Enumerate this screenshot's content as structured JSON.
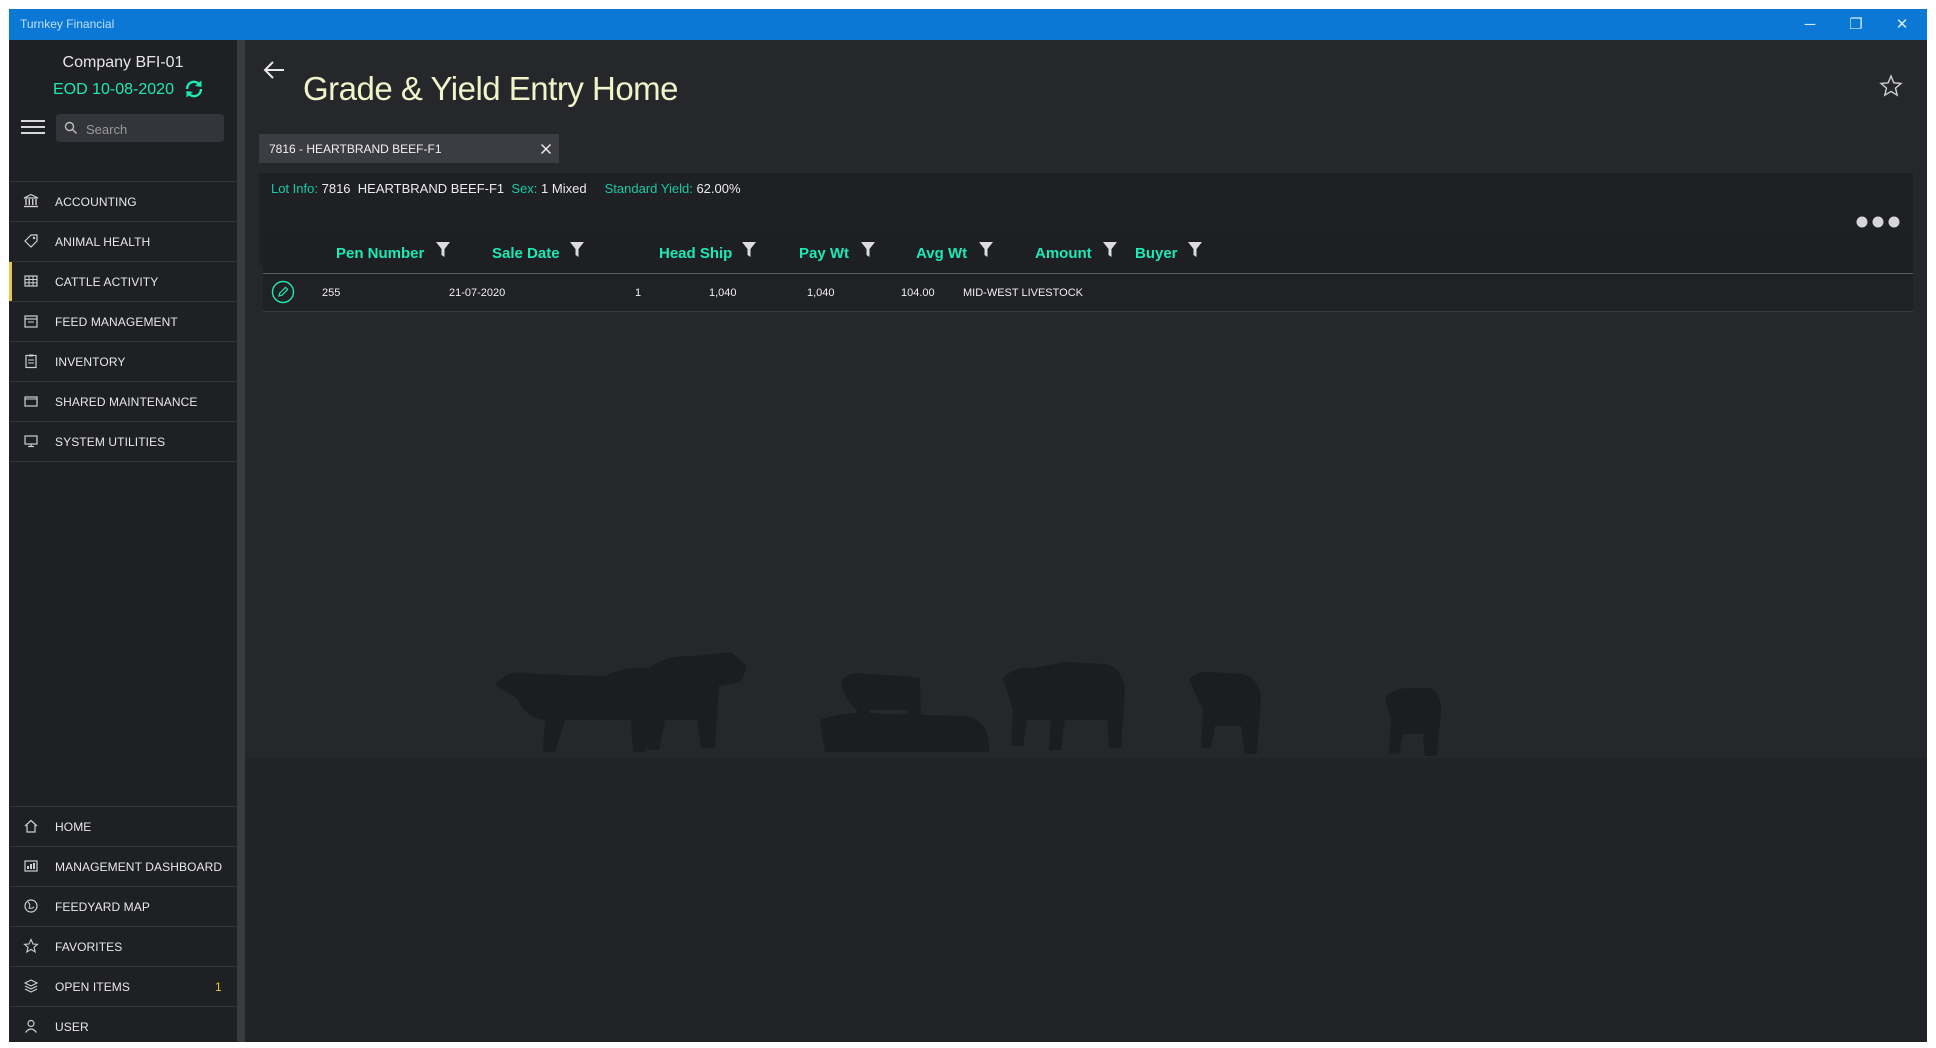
{
  "window": {
    "title": "Turnkey Financial",
    "minimize_glyph": "─",
    "restore_glyph": "❐",
    "close_glyph": "✕"
  },
  "sidebar": {
    "company": "Company BFI-01",
    "eod": "EOD 10-08-2020",
    "search_placeholder": "Search",
    "nav_items": [
      {
        "label": "ACCOUNTING",
        "icon": "bank-icon"
      },
      {
        "label": "ANIMAL HEALTH",
        "icon": "tag-icon"
      },
      {
        "label": "CATTLE ACTIVITY",
        "icon": "grid-icon",
        "active": true
      },
      {
        "label": "FEED MANAGEMENT",
        "icon": "calendar-icon"
      },
      {
        "label": "INVENTORY",
        "icon": "clipboard-icon"
      },
      {
        "label": "SHARED MAINTENANCE",
        "icon": "folder-icon"
      },
      {
        "label": "SYSTEM UTILITIES",
        "icon": "monitor-icon"
      }
    ],
    "bottom_items": [
      {
        "label": "HOME",
        "icon": "home-icon"
      },
      {
        "label": "MANAGEMENT DASHBOARD",
        "icon": "dashboard-icon"
      },
      {
        "label": "FEEDYARD MAP",
        "icon": "globe-icon"
      },
      {
        "label": "FAVORITES",
        "icon": "star-icon"
      },
      {
        "label": "OPEN ITEMS",
        "icon": "layers-icon",
        "badge": "1"
      },
      {
        "label": "USER",
        "icon": "user-icon"
      }
    ]
  },
  "main": {
    "page_title": "Grade & Yield Entry Home",
    "tab": {
      "label": "7816 - HEARTBRAND BEEF-F1"
    },
    "lot_info": {
      "lot_key": "Lot Info:",
      "lot_number": "7816",
      "lot_name": "HEARTBRAND BEEF-F1",
      "sex_key": "Sex:",
      "sex_value": "1 Mixed",
      "yield_key": "Standard Yield:",
      "yield_value": "62.00%"
    },
    "table": {
      "columns": [
        "Pen Number",
        "Sale Date",
        "Head Ship",
        "Pay Wt",
        "Avg Wt",
        "Amount",
        "Buyer"
      ],
      "rows": [
        {
          "pen_number": "255",
          "sale_date": "21-07-2020",
          "head_ship": "1",
          "pay_wt": "1,040",
          "avg_wt": "1,040",
          "amount": "104.00",
          "buyer": "MID-WEST LIVESTOCK"
        }
      ]
    }
  },
  "colors": {
    "accent": "#1de9b6",
    "titlebar": "#0a78d4",
    "badge": "#f0c420",
    "active_marker": "#e7c54b"
  }
}
